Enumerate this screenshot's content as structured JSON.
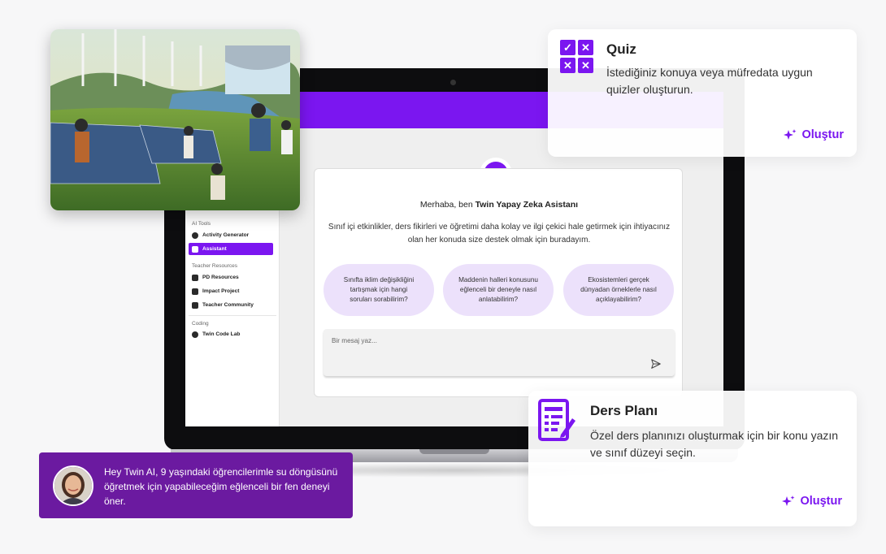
{
  "sidebar": {
    "sections": [
      {
        "label": "AI Tools",
        "items": [
          {
            "label": "Activity Generator",
            "active": false
          },
          {
            "label": "Assistant",
            "active": true
          }
        ]
      },
      {
        "label": "Teacher Resources",
        "items": [
          {
            "label": "PD Resources",
            "active": false
          },
          {
            "label": "Impact Project",
            "active": false
          },
          {
            "label": "Teacher Community",
            "active": false
          }
        ]
      },
      {
        "label": "Coding",
        "items": [
          {
            "label": "Twin Code Lab",
            "active": false
          }
        ]
      }
    ]
  },
  "chat": {
    "greeting_prefix": "Merhaba, ben",
    "assistant_name": "Twin Yapay Zeka Asistanı",
    "intro": "Sınıf içi etkinlikler, ders fikirleri ve öğretimi daha kolay ve ilgi çekici hale getirmek için ihtiyacınız olan her konuda size destek olmak için buradayım.",
    "suggestions": [
      "Sınıfta iklim değişikliğini tartışmak için hangi soruları sorabilirim?",
      "Maddenin halleri konusunu eğlenceli bir deneyle nasıl anlatabilirim?",
      "Ekosistemleri gerçek dünyadan örneklerle nasıl açıklayabilirim?"
    ],
    "input_placeholder": "Bir mesaj yaz..."
  },
  "quiz_card": {
    "title": "Quiz",
    "description": "İstediğiniz konuya veya müfredata uygun quizler oluşturun.",
    "button": "Oluştur"
  },
  "plan_card": {
    "title": "Ders Planı",
    "description": "Özel ders planınızı oluşturmak için bir konu yazın ve sınıf düzeyi seçin.",
    "button": "Oluştur"
  },
  "bubble": {
    "text": "Hey Twin AI, 9 yaşındaki öğrencilerimle su döngüsünü öğretmek için yapabileceğim eğlenceli bir fen deneyi öner."
  },
  "colors": {
    "accent": "#7b16f0",
    "bubble": "#6b1aa0",
    "suggestion_bg": "#ece1fb"
  }
}
